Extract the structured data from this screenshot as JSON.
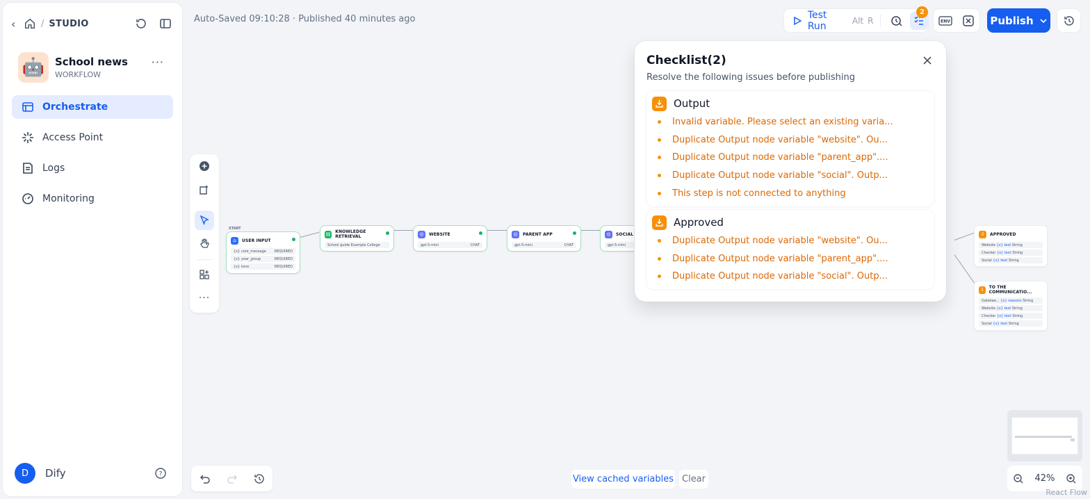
{
  "header": {
    "studio": "STUDIO",
    "autosave": "Auto-Saved 09:10:28 · Published 40 minutes ago"
  },
  "app": {
    "name": "School news",
    "type": "WORKFLOW",
    "avatar": "🤖"
  },
  "menu": [
    {
      "label": "Orchestrate",
      "icon": "orchestrate-icon"
    },
    {
      "label": "Access Point",
      "icon": "access-point-icon"
    },
    {
      "label": "Logs",
      "icon": "logs-icon"
    },
    {
      "label": "Monitoring",
      "icon": "monitoring-icon"
    }
  ],
  "user": {
    "initial": "D",
    "name": "Dify"
  },
  "toolbar": {
    "test_run": "Test Run",
    "kbd_alt": "Alt",
    "kbd_r": "R",
    "checklist_count": "2",
    "publish": "Publish"
  },
  "canvas": {
    "start_label": "START",
    "nodes": {
      "user_input": {
        "title": "USER INPUT",
        "rows": [
          {
            "name": "{x} core_message",
            "tag": "REQUIRED"
          },
          {
            "name": "{x} year_group",
            "tag": "REQUIRED"
          },
          {
            "name": "{x} tone",
            "tag": "REQUIRED"
          }
        ]
      },
      "knowledge": {
        "title": "KNOWLEDGE RETRIEVAL",
        "row": "School guide Example College"
      },
      "website": {
        "title": "WEBSITE",
        "model": "gpt-5-mini",
        "tag": "CHAT"
      },
      "parent_app": {
        "title": "PARENT APP",
        "model": "gpt-5-mini",
        "tag": "CHAT"
      },
      "social": {
        "title": "SOCIAL",
        "model": "gpt-5-mini"
      },
      "approved": {
        "title": "APPROVED",
        "rows": [
          {
            "name": "Website",
            "var": "{x} text",
            "type": "String"
          },
          {
            "name": "Checker",
            "var": "{x} text",
            "type": "String"
          },
          {
            "name": "Social",
            "var": "{x} text",
            "type": "String"
          }
        ]
      },
      "to_comm": {
        "title": "TO THE COMMUNICATIO...",
        "rows": [
          {
            "name": "Gatekee...",
            "var": "{x} reasons",
            "type": "String"
          },
          {
            "name": "Website",
            "var": "{x} text",
            "type": "String"
          },
          {
            "name": "Checker",
            "var": "{x} text",
            "type": "String"
          },
          {
            "name": "Social",
            "var": "{x} text",
            "type": "String"
          }
        ]
      }
    }
  },
  "checklist": {
    "title": "Checklist(2)",
    "subtitle": "Resolve the following issues before publishing",
    "groups": [
      {
        "name": "Output",
        "issues": [
          "Invalid variable. Please select an existing varia...",
          "Duplicate Output node variable \"website\". Ou...",
          "Duplicate Output node variable \"parent_app\"....",
          "Duplicate Output node variable \"social\". Outp...",
          "This step is not connected to anything"
        ]
      },
      {
        "name": "Approved",
        "issues": [
          "Duplicate Output node variable \"website\". Ou...",
          "Duplicate Output node variable \"parent_app\"....",
          "Duplicate Output node variable \"social\". Outp..."
        ]
      }
    ]
  },
  "bottom": {
    "view_cached": "View cached variables",
    "clear": "Clear",
    "zoom": "42%",
    "react_flow": "React Flow"
  }
}
